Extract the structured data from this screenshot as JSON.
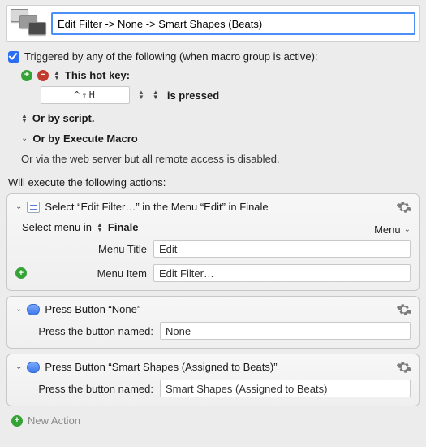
{
  "title_value": "Edit Filter -> None -> Smart Shapes (Beats)",
  "trigger_heading": "Triggered by any of the following (when macro group is active):",
  "hotkey_label": "This hot key:",
  "hotkey_value": "^⇧H",
  "hotkey_condition": "is pressed",
  "or_script": "Or by script.",
  "or_execute_macro": "Or by Execute Macro",
  "webserver_line": "Or via the web server but all remote access is disabled.",
  "exec_heading": "Will execute the following actions:",
  "action1": {
    "title": "Select “Edit Filter…” in the Menu “Edit” in Finale",
    "select_menu_in": "Select menu in",
    "app_name": "Finale",
    "menu_link": "Menu",
    "menu_title_label": "Menu Title",
    "menu_title_value": "Edit",
    "menu_item_label": "Menu Item",
    "menu_item_value": "Edit Filter…"
  },
  "action2": {
    "title": "Press Button “None”",
    "button_label": "Press the button named:",
    "button_value": "None"
  },
  "action3": {
    "title": "Press Button “Smart Shapes (Assigned to Beats)”",
    "button_label": "Press the button named:",
    "button_value": "Smart Shapes (Assigned to Beats)"
  },
  "new_action": "New Action"
}
